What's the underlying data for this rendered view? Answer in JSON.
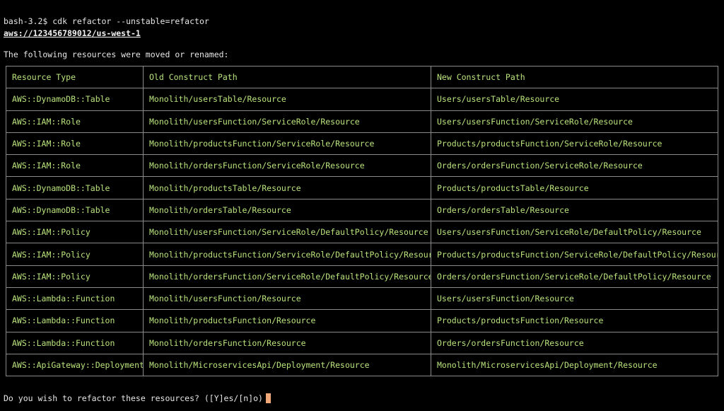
{
  "terminal": {
    "prompt": "bash-3.2$ cdk refactor --unstable=refactor",
    "account": "aws://123456789012/us-west-1",
    "intro": "The following resources were moved or renamed:",
    "question": "Do you wish to refactor these resources? ([Y]es/[n]o)",
    "text_color": "#e6e6e6",
    "table_text_color": "#b9e37b",
    "cursor_color": "#f0a878"
  },
  "table": {
    "headers": [
      "Resource Type",
      "Old Construct Path",
      "New Construct Path"
    ],
    "rows": [
      [
        "AWS::DynamoDB::Table",
        "Monolith/usersTable/Resource",
        "Users/usersTable/Resource"
      ],
      [
        "AWS::IAM::Role",
        "Monolith/usersFunction/ServiceRole/Resource",
        "Users/usersFunction/ServiceRole/Resource"
      ],
      [
        "AWS::IAM::Role",
        "Monolith/productsFunction/ServiceRole/Resource",
        "Products/productsFunction/ServiceRole/Resource"
      ],
      [
        "AWS::IAM::Role",
        "Monolith/ordersFunction/ServiceRole/Resource",
        "Orders/ordersFunction/ServiceRole/Resource"
      ],
      [
        "AWS::DynamoDB::Table",
        "Monolith/productsTable/Resource",
        "Products/productsTable/Resource"
      ],
      [
        "AWS::DynamoDB::Table",
        "Monolith/ordersTable/Resource",
        "Orders/ordersTable/Resource"
      ],
      [
        "AWS::IAM::Policy",
        "Monolith/usersFunction/ServiceRole/DefaultPolicy/Resource",
        "Users/usersFunction/ServiceRole/DefaultPolicy/Resource"
      ],
      [
        "AWS::IAM::Policy",
        "Monolith/productsFunction/ServiceRole/DefaultPolicy/Resource",
        "Products/productsFunction/ServiceRole/DefaultPolicy/Resource"
      ],
      [
        "AWS::IAM::Policy",
        "Monolith/ordersFunction/ServiceRole/DefaultPolicy/Resource",
        "Orders/ordersFunction/ServiceRole/DefaultPolicy/Resource"
      ],
      [
        "AWS::Lambda::Function",
        "Monolith/usersFunction/Resource",
        "Users/usersFunction/Resource"
      ],
      [
        "AWS::Lambda::Function",
        "Monolith/productsFunction/Resource",
        "Products/productsFunction/Resource"
      ],
      [
        "AWS::Lambda::Function",
        "Monolith/ordersFunction/Resource",
        "Orders/ordersFunction/Resource"
      ],
      [
        "AWS::ApiGateway::Deployment",
        "Monolith/MicroservicesApi/Deployment/Resource",
        "Monolith/MicroservicesApi/Deployment/Resource"
      ]
    ]
  }
}
